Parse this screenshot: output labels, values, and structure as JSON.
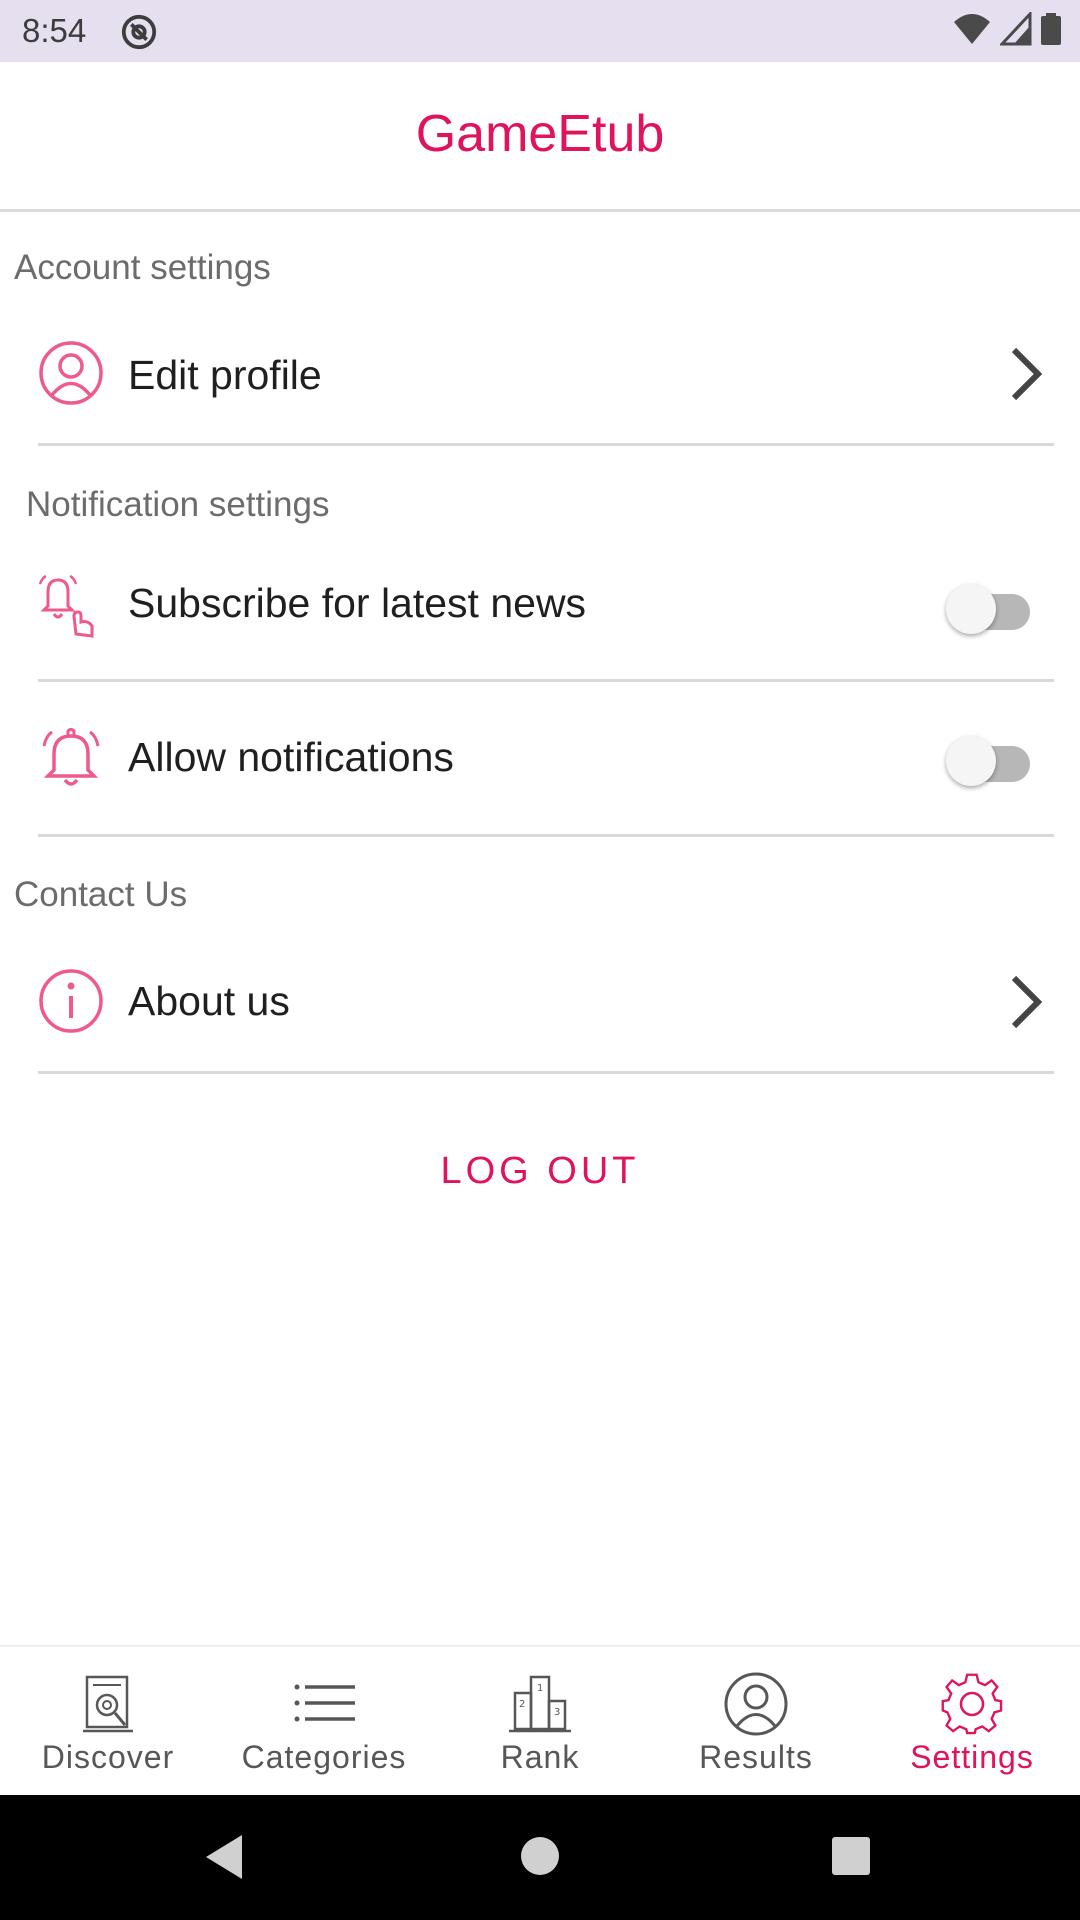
{
  "status_bar": {
    "time": "8:54"
  },
  "app_bar": {
    "title": "GameEtub"
  },
  "sections": {
    "account": "Account settings",
    "notification": "Notification settings",
    "contact": "Contact Us"
  },
  "rows": {
    "edit_profile": "Edit profile",
    "subscribe": "Subscribe for latest news",
    "allow_notifications": "Allow notifications",
    "about_us": "About us"
  },
  "toggles": {
    "subscribe_on": false,
    "notifications_on": false
  },
  "logout_label": "LOG OUT",
  "bottom_nav": {
    "items": [
      {
        "label": "Discover",
        "icon": "discover-icon",
        "active": false
      },
      {
        "label": "Categories",
        "icon": "list-icon",
        "active": false
      },
      {
        "label": "Rank",
        "icon": "podium-icon",
        "active": false
      },
      {
        "label": "Results",
        "icon": "user-circle-icon",
        "active": false
      },
      {
        "label": "Settings",
        "icon": "gear-icon",
        "active": true
      }
    ]
  },
  "colors": {
    "accent": "#e0135f",
    "icon_pink": "#ee5a8c",
    "statusbar": "#e6dff0"
  }
}
